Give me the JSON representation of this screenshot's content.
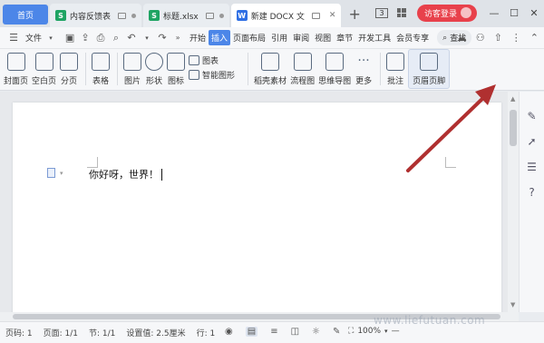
{
  "tabs": {
    "home": "首页",
    "items": [
      {
        "label": "内容反馈表",
        "type": "s"
      },
      {
        "label": "标题.xlsx",
        "type": "s"
      },
      {
        "label": "新建 DOCX 文",
        "type": "w"
      }
    ],
    "counter": "3",
    "login": "访客登录"
  },
  "menubar": {
    "file": "文件",
    "items": [
      "开始",
      "插入",
      "页面布局",
      "引用",
      "审阅",
      "视图",
      "章节",
      "开发工具",
      "会员专享"
    ],
    "active": "插入",
    "search": "查找"
  },
  "ribbon": {
    "cover": "封面页",
    "blank": "空白页",
    "pagebreak": "分页",
    "table": "表格",
    "picture": "图片",
    "shape": "形状",
    "icon": "图标",
    "chart": "图表",
    "smartart": "智能图形",
    "material": "稻壳素材",
    "flowchart": "流程图",
    "mindmap": "思维导图",
    "more": "更多",
    "comment": "批注",
    "header_footer": "页眉页脚"
  },
  "document": {
    "text": "你好呀，世界！"
  },
  "status": {
    "page_no": "页码: 1",
    "page": "页面: 1/1",
    "section": "节: 1/1",
    "setting": "设置值: 2.5厘米",
    "row": "行: 1",
    "zoom": "100%"
  },
  "watermark": "www.liefutuan.com",
  "colors": {
    "accent": "#4c86e8",
    "login": "#e8414b",
    "arrow": "#b03030"
  }
}
